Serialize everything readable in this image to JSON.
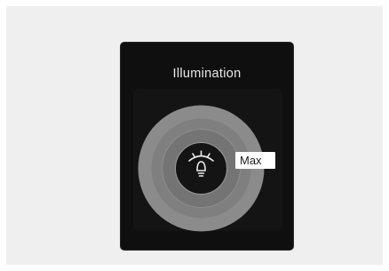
{
  "panel": {
    "title": "Illumination",
    "level_label": "Max"
  },
  "icons": {
    "center": "dashboard-illumination-icon"
  },
  "colors": {
    "background": "#efefef",
    "screen": "#0f0f0f",
    "dial_outer": "#8a8a8a",
    "dial_inner": "#6f6f6f",
    "badge": "#ffffff"
  }
}
